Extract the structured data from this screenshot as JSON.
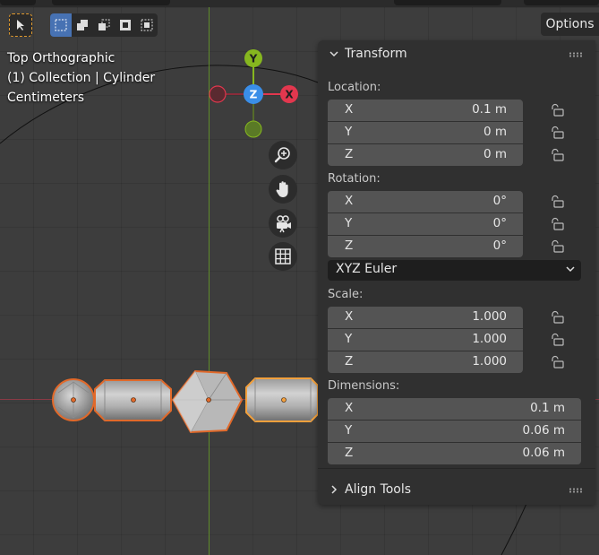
{
  "viewport": {
    "info": [
      "Top Orthographic",
      "(1) Collection | Cylinder",
      "Centimeters"
    ],
    "gizmo": {
      "y": "Y",
      "z": "Z",
      "x": "X"
    },
    "options_label": "Options",
    "colors": {
      "x_axis": "#e2374e",
      "y_axis": "#86b71f",
      "z_axis": "#3a8ee8",
      "selection": "#e1692a",
      "active": "#f2a03c"
    }
  },
  "transform_panel": {
    "title": "Transform",
    "location": {
      "label": "Location:",
      "rows": [
        {
          "axis": "X",
          "value": "0.1 m"
        },
        {
          "axis": "Y",
          "value": "0 m"
        },
        {
          "axis": "Z",
          "value": "0 m"
        }
      ]
    },
    "rotation": {
      "label": "Rotation:",
      "rows": [
        {
          "axis": "X",
          "value": "0°"
        },
        {
          "axis": "Y",
          "value": "0°"
        },
        {
          "axis": "Z",
          "value": "0°"
        }
      ],
      "mode": "XYZ Euler"
    },
    "scale": {
      "label": "Scale:",
      "rows": [
        {
          "axis": "X",
          "value": "1.000"
        },
        {
          "axis": "Y",
          "value": "1.000"
        },
        {
          "axis": "Z",
          "value": "1.000"
        }
      ]
    },
    "dimensions": {
      "label": "Dimensions:",
      "rows": [
        {
          "axis": "X",
          "value": "0.1 m"
        },
        {
          "axis": "Y",
          "value": "0.06 m"
        },
        {
          "axis": "Z",
          "value": "0.06 m"
        }
      ]
    }
  },
  "align_tools": {
    "title": "Align Tools"
  }
}
